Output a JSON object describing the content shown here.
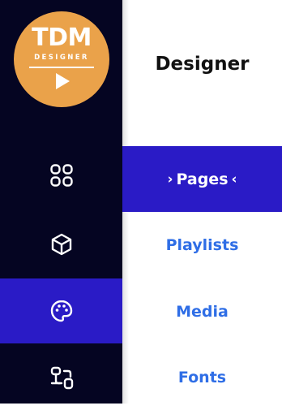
{
  "logo": {
    "title": "TDM",
    "subtitle": "DESIGNER",
    "icon": "play-icon",
    "color": "#EAA24A"
  },
  "sidebar": {
    "background": "#050522",
    "active_color": "#2A1BC6",
    "items": [
      {
        "icon": "grid-icon",
        "active": false
      },
      {
        "icon": "cube-icon",
        "active": false
      },
      {
        "icon": "palette-icon",
        "active": true
      },
      {
        "icon": "workflow-icon",
        "active": false
      }
    ]
  },
  "panel": {
    "title": "Designer",
    "link_color": "#2F6EE6",
    "items": [
      {
        "label": "Pages",
        "active": true,
        "chevron_left": "›",
        "chevron_right": "‹"
      },
      {
        "label": "Playlists",
        "active": false
      },
      {
        "label": "Media",
        "active": false
      },
      {
        "label": "Fonts",
        "active": false
      }
    ]
  }
}
